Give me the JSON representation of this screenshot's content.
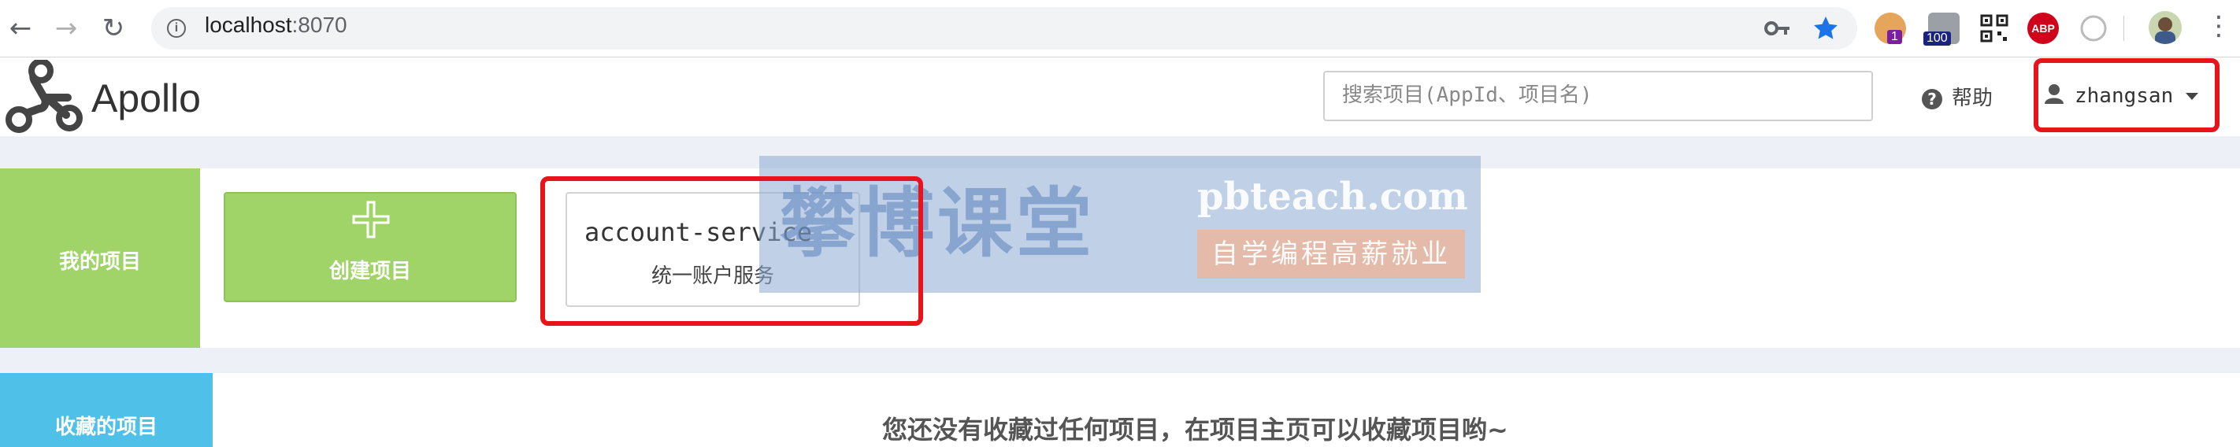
{
  "browser": {
    "url_host": "localhost",
    "url_port": ":8070",
    "extensions": [
      {
        "name": "monkey-extension-icon",
        "badge": "1"
      },
      {
        "name": "tab-counter-extension-icon",
        "badge": "100"
      },
      {
        "name": "qr-code-extension-icon",
        "badge": ""
      },
      {
        "name": "adblock-plus-extension-icon",
        "label": "ABP"
      },
      {
        "name": "compass-extension-icon",
        "badge": ""
      }
    ]
  },
  "header": {
    "logo_text": "Apollo",
    "search_placeholder": "搜索项目(AppId、项目名)",
    "help_label": "帮助",
    "username": "zhangsan"
  },
  "my_projects": {
    "section_label": "我的项目",
    "create_label": "创建项目",
    "projects": [
      {
        "app_id": "account-service",
        "name": "统一账户服务"
      }
    ]
  },
  "favorites": {
    "section_label": "收藏的项目",
    "empty_message": "您还没有收藏过任何项目，在项目主页可以收藏项目哟~"
  },
  "watermark": {
    "cn": "攀博课堂",
    "en": "pbteach.com",
    "tag": "自学编程高薪就业"
  },
  "colors": {
    "green": "#a0d468",
    "blue": "#4fc1e9",
    "highlight_red": "#e8141b"
  }
}
